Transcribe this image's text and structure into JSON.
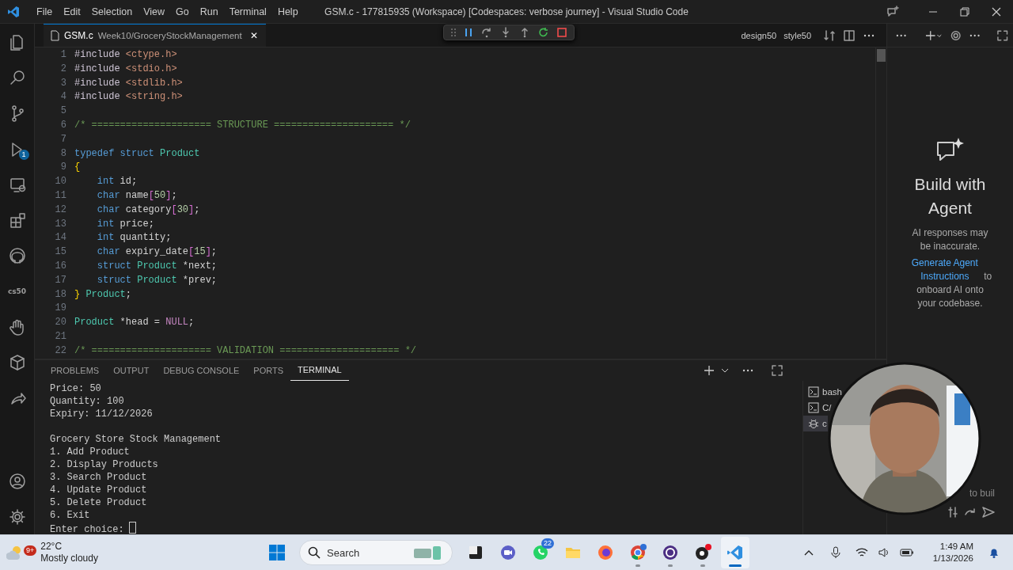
{
  "window": {
    "title": "GSM.c - 177815935 (Workspace) [Codespaces: verbose journey] - Visual Studio Code"
  },
  "menu": [
    "File",
    "Edit",
    "Selection",
    "View",
    "Go",
    "Run",
    "Terminal",
    "Help"
  ],
  "activity_bar": {
    "debug_badge": "1",
    "cs50_label": "cs50"
  },
  "editor": {
    "tab": {
      "file": "GSM.c",
      "path": "Week10/GroceryStockManagement",
      "close": "✕"
    },
    "actions": [
      "design50",
      "style50"
    ],
    "lines": [
      {
        "number": "1",
        "tokens": [
          {
            "text": "#include ",
            "kind": "pre"
          },
          {
            "text": "<ctype.h>",
            "kind": "str"
          }
        ]
      },
      {
        "number": "2",
        "tokens": [
          {
            "text": "#include ",
            "kind": "pre"
          },
          {
            "text": "<stdio.h>",
            "kind": "str"
          }
        ]
      },
      {
        "number": "3",
        "tokens": [
          {
            "text": "#include ",
            "kind": "pre"
          },
          {
            "text": "<stdlib.h>",
            "kind": "str"
          }
        ]
      },
      {
        "number": "4",
        "tokens": [
          {
            "text": "#include ",
            "kind": "pre"
          },
          {
            "text": "<string.h>",
            "kind": "str"
          }
        ]
      },
      {
        "number": "5"
      },
      {
        "number": "6",
        "tokens": [
          {
            "text": "/* ===================== STRUCTURE ===================== */",
            "kind": "cmt"
          }
        ]
      },
      {
        "number": "7"
      },
      {
        "number": "8",
        "tokens": [
          {
            "text": "typedef struct ",
            "kind": "kw"
          },
          {
            "text": "Product",
            "kind": "type"
          }
        ]
      },
      {
        "number": "9",
        "tokens": [
          {
            "text": "{",
            "kind": "brace"
          }
        ]
      },
      {
        "number": "10",
        "tokens": [
          {
            "text": "    int",
            "kind": "kw"
          },
          {
            "text": " id;",
            "kind": "plain"
          }
        ]
      },
      {
        "number": "11",
        "tokens": [
          {
            "text": "    char",
            "kind": "kw"
          },
          {
            "text": " name",
            "kind": "plain"
          },
          {
            "text": "[",
            "kind": "brk"
          },
          {
            "text": "50",
            "kind": "num"
          },
          {
            "text": "]",
            "kind": "brk"
          },
          {
            "text": ";",
            "kind": "plain"
          }
        ]
      },
      {
        "number": "12",
        "tokens": [
          {
            "text": "    char",
            "kind": "kw"
          },
          {
            "text": " category",
            "kind": "plain"
          },
          {
            "text": "[",
            "kind": "brk"
          },
          {
            "text": "30",
            "kind": "num"
          },
          {
            "text": "]",
            "kind": "brk"
          },
          {
            "text": ";",
            "kind": "plain"
          }
        ]
      },
      {
        "number": "13",
        "tokens": [
          {
            "text": "    int",
            "kind": "kw"
          },
          {
            "text": " price;",
            "kind": "plain"
          }
        ]
      },
      {
        "number": "14",
        "tokens": [
          {
            "text": "    int",
            "kind": "kw"
          },
          {
            "text": " quantity;",
            "kind": "plain"
          }
        ]
      },
      {
        "number": "15",
        "tokens": [
          {
            "text": "    char",
            "kind": "kw"
          },
          {
            "text": " expiry_date",
            "kind": "plain"
          },
          {
            "text": "[",
            "kind": "brk"
          },
          {
            "text": "15",
            "kind": "num"
          },
          {
            "text": "]",
            "kind": "brk"
          },
          {
            "text": ";",
            "kind": "plain"
          }
        ]
      },
      {
        "number": "16",
        "tokens": [
          {
            "text": "    struct ",
            "kind": "kw"
          },
          {
            "text": "Product",
            "kind": "type"
          },
          {
            "text": " *next;",
            "kind": "plain"
          }
        ]
      },
      {
        "number": "17",
        "tokens": [
          {
            "text": "    struct ",
            "kind": "kw"
          },
          {
            "text": "Product",
            "kind": "type"
          },
          {
            "text": " *prev;",
            "kind": "plain"
          }
        ]
      },
      {
        "number": "18",
        "tokens": [
          {
            "text": "}",
            "kind": "brace"
          },
          {
            "text": " Product",
            "kind": "type"
          },
          {
            "text": ";",
            "kind": "plain"
          }
        ]
      },
      {
        "number": "19"
      },
      {
        "number": "20",
        "tokens": [
          {
            "text": "Product",
            "kind": "type"
          },
          {
            "text": " *head = ",
            "kind": "plain"
          },
          {
            "text": "NULL",
            "kind": "null"
          },
          {
            "text": ";",
            "kind": "plain"
          }
        ]
      },
      {
        "number": "21"
      },
      {
        "number": "22",
        "tokens": [
          {
            "text": "/* ===================== VALIDATION ===================== */",
            "kind": "cmt"
          }
        ]
      }
    ]
  },
  "chat": {
    "title": "Build with Agent",
    "note": "AI responses may be inaccurate.",
    "link": "Generate Agent Instructions",
    "rest": " to onboard AI onto your codebase.",
    "input_text": "to buil"
  },
  "panel": {
    "tabs": [
      {
        "label": "PROBLEMS",
        "selected": false
      },
      {
        "label": "OUTPUT",
        "selected": false
      },
      {
        "label": "DEBUG CONSOLE",
        "selected": false
      },
      {
        "label": "PORTS",
        "selected": false
      },
      {
        "label": "TERMINAL",
        "selected": true
      }
    ],
    "output": [
      [
        "Price: 50",
        "Quantity: 100",
        "Expiry: 11/12/2026"
      ],
      [
        "Grocery Store Stock Management",
        "1. Add Product",
        "2. Display Products",
        "3. Search Product",
        "4. Update Product",
        "5. Delete Product",
        "6. Exit",
        "Enter choice:"
      ]
    ],
    "terminals": [
      {
        "kind": "shell",
        "label": "bash",
        "selected": false
      },
      {
        "kind": "shell",
        "label": "C/",
        "selected": false
      },
      {
        "kind": "debug",
        "label": "c",
        "selected": true
      }
    ]
  },
  "webcam": {
    "kind": "picture"
  },
  "taskbar": {
    "weather": {
      "badge": "9+",
      "temp": "22°C",
      "condition": "Mostly cloudy"
    },
    "search": {
      "placeholder": "Search"
    },
    "apps": [
      {
        "kind": "notes",
        "running": false,
        "selected": false
      },
      {
        "kind": "meet",
        "running": false,
        "selected": false
      },
      {
        "kind": "whatsapp",
        "badge": "22",
        "running": false,
        "selected": false
      },
      {
        "kind": "folder",
        "running": false,
        "selected": false
      },
      {
        "kind": "firefox",
        "running": false,
        "selected": false
      },
      {
        "kind": "chrome",
        "running": true,
        "selected": false
      },
      {
        "kind": "obs",
        "running": true,
        "selected": false
      },
      {
        "kind": "media",
        "running": true,
        "selected": false
      },
      {
        "kind": "vscode",
        "running": true,
        "selected": true
      }
    ],
    "time": "1:49 AM",
    "date": "1/13/2026"
  }
}
